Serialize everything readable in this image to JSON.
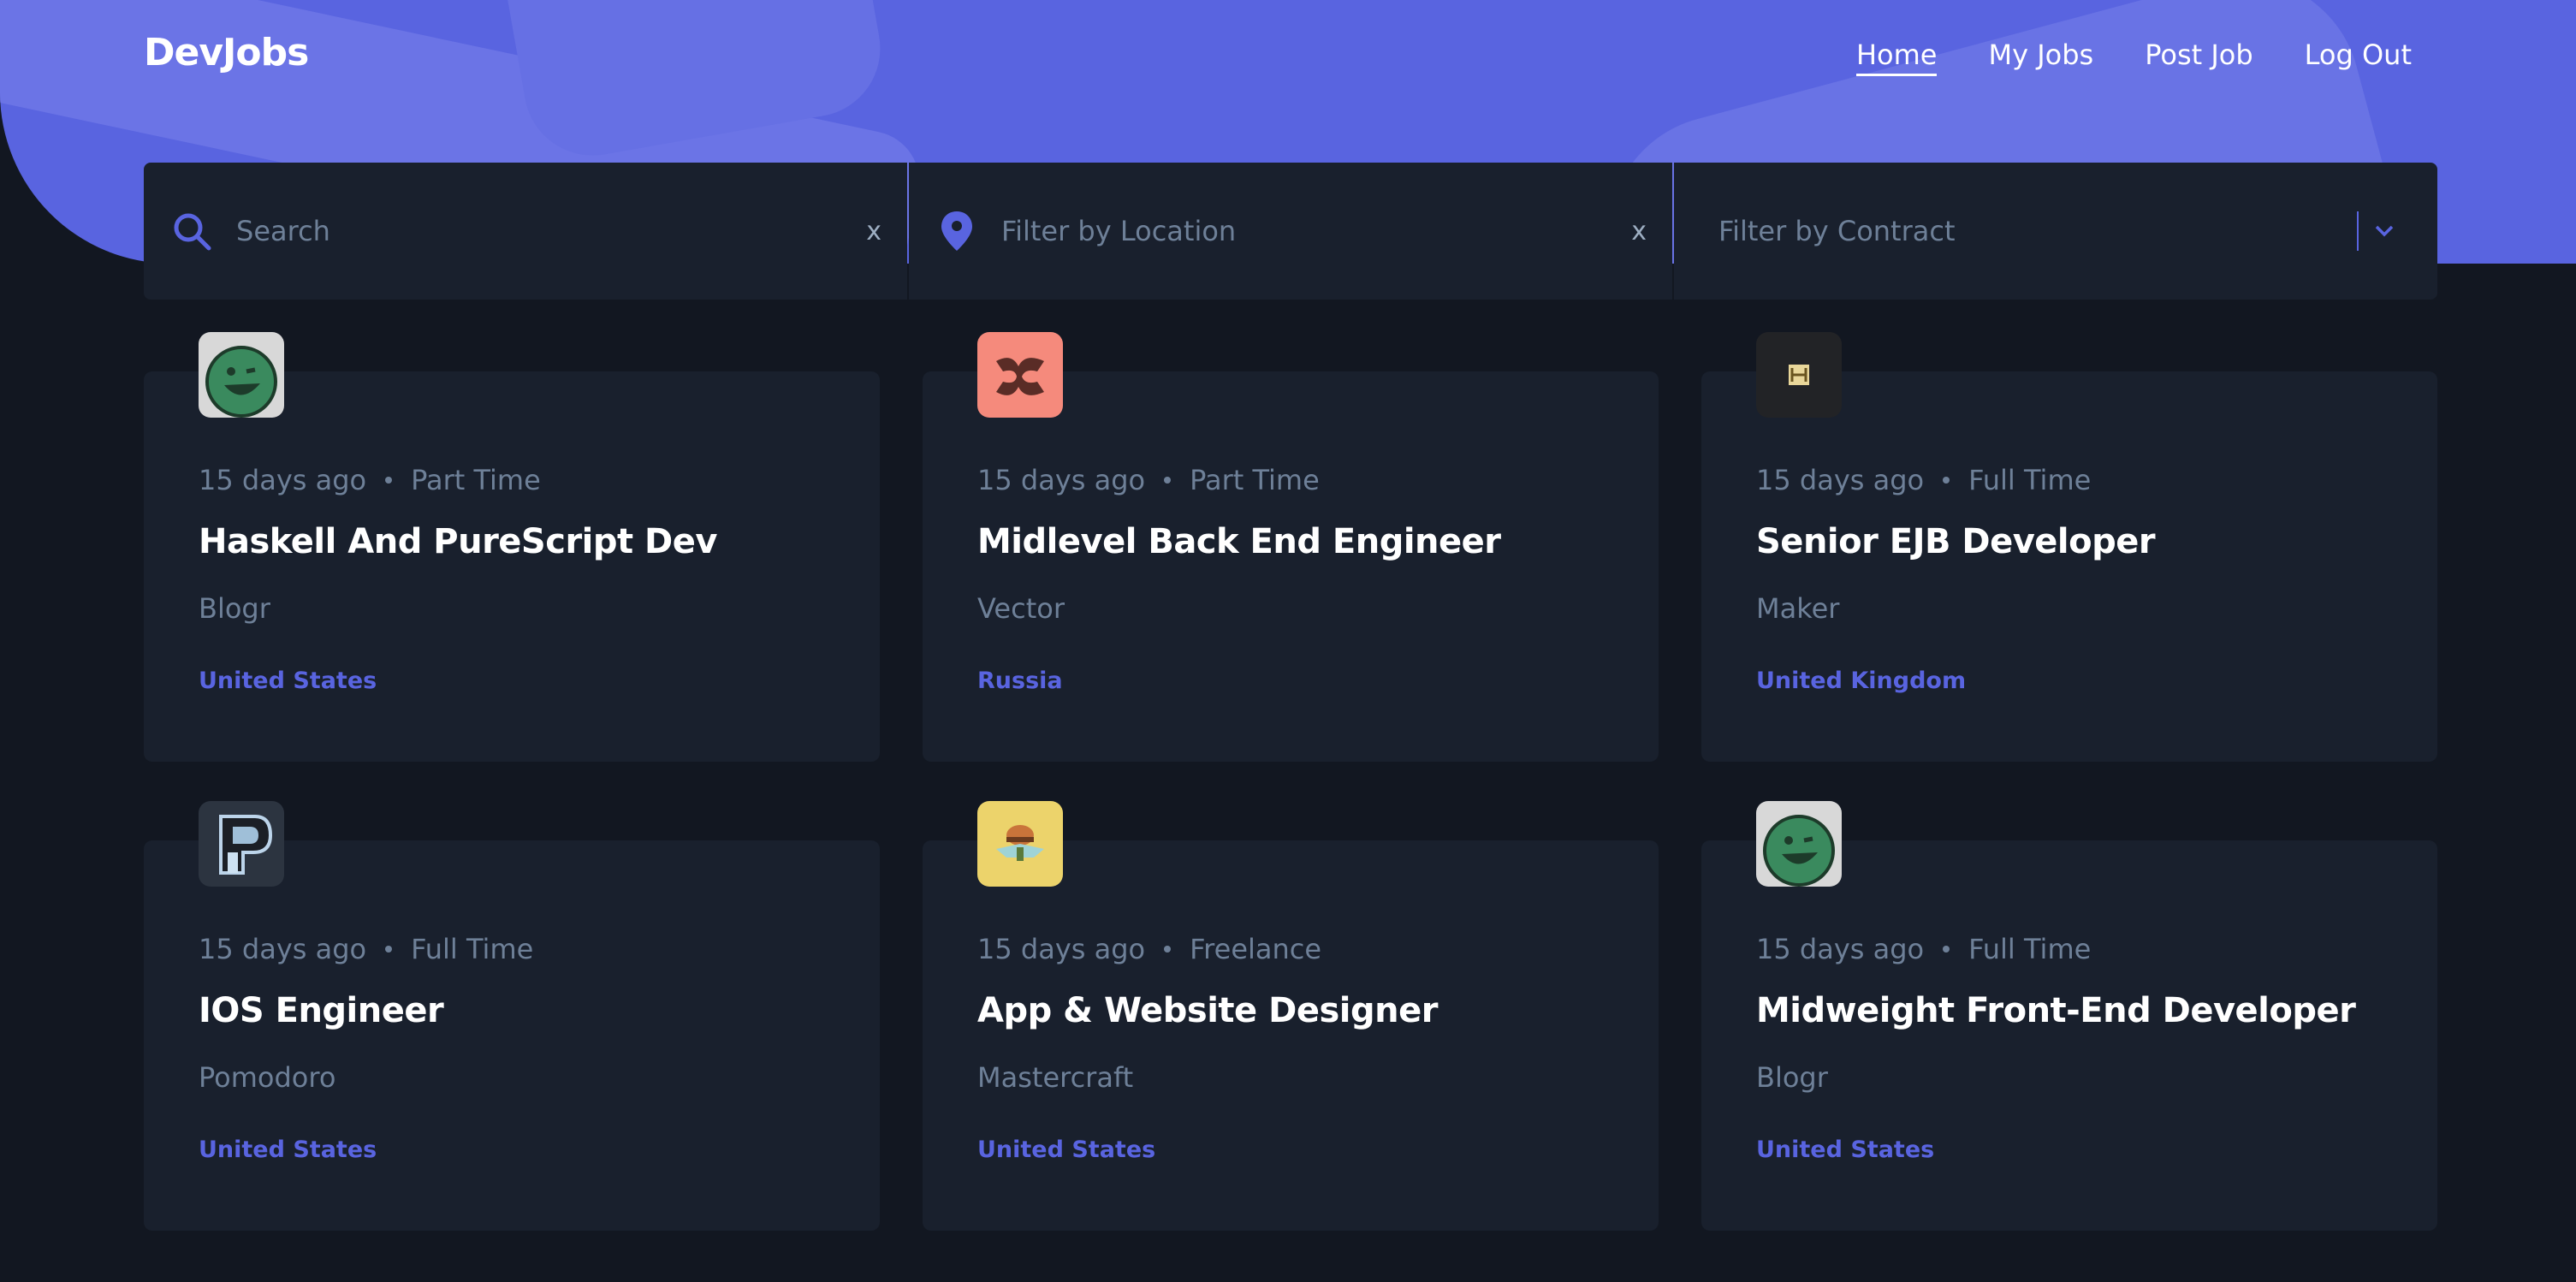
{
  "brand": {
    "name": "DevJobs",
    "accent": "#5964e0"
  },
  "nav": {
    "items": [
      {
        "label": "Home",
        "active": true
      },
      {
        "label": "My Jobs",
        "active": false
      },
      {
        "label": "Post Job",
        "active": false
      },
      {
        "label": "Log Out",
        "active": false
      }
    ]
  },
  "filters": {
    "search": {
      "placeholder": "Search",
      "icon": "search-icon",
      "clear": "x"
    },
    "location": {
      "placeholder": "Filter by Location",
      "icon": "location-pin-icon",
      "clear": "x"
    },
    "contract": {
      "placeholder": "Filter by Contract",
      "icon": "chevron-down-icon"
    }
  },
  "jobs": [
    {
      "posted": "15 days ago",
      "contract": "Part Time",
      "title": "Haskell And PureScript Dev",
      "company": "Blogr",
      "location": "United States",
      "logo": "blogr-logo"
    },
    {
      "posted": "15 days ago",
      "contract": "Part Time",
      "title": "Midlevel Back End Engineer",
      "company": "Vector",
      "location": "Russia",
      "logo": "vector-logo"
    },
    {
      "posted": "15 days ago",
      "contract": "Full Time",
      "title": "Senior EJB Developer",
      "company": "Maker",
      "location": "United Kingdom",
      "logo": "maker-logo"
    },
    {
      "posted": "15 days ago",
      "contract": "Full Time",
      "title": "IOS Engineer",
      "company": "Pomodoro",
      "location": "United States",
      "logo": "pomodoro-logo"
    },
    {
      "posted": "15 days ago",
      "contract": "Freelance",
      "title": "App & Website Designer",
      "company": "Mastercraft",
      "location": "United States",
      "logo": "mastercraft-logo"
    },
    {
      "posted": "15 days ago",
      "contract": "Full Time",
      "title": "Midweight Front-End Developer",
      "company": "Blogr",
      "location": "United States",
      "logo": "blogr-logo"
    }
  ]
}
